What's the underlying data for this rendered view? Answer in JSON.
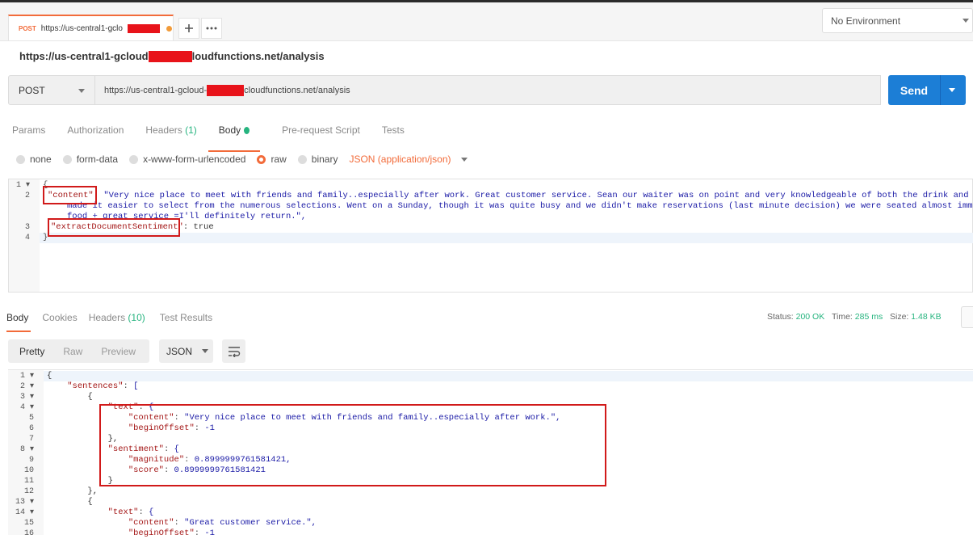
{
  "request_tab": {
    "method": "POST",
    "url": "https://us-central1-gclo"
  },
  "env": {
    "label": "No Environment"
  },
  "title": {
    "pre": "https://us-central1-gcloud",
    "post": "loudfunctions.net/analysis"
  },
  "request": {
    "method": "POST",
    "url_pre": "https://us-central1-gcloud-",
    "url_post": "cloudfunctions.net/analysis",
    "send_label": "Send"
  },
  "req_tabs": {
    "params": "Params",
    "authorization": "Authorization",
    "headers": "Headers",
    "headers_count": "(1)",
    "body": "Body",
    "prerequest": "Pre-request Script",
    "tests": "Tests"
  },
  "body_types": {
    "none": "none",
    "formdata": "form-data",
    "urlencoded": "x-www-form-urlencoded",
    "raw": "raw",
    "binary": "binary",
    "content_type": "JSON (application/json)"
  },
  "request_body": {
    "line1": "{",
    "line2_key": "\"content\"",
    "line2_val": "\"Very nice place to meet with friends and family..especially after work. Great customer service. Sean our waiter was on point and very knowledgeable of both the drink and food",
    "line2_wrap1": "made it easier to select from the numerous selections. Went on a Sunday, though it was quite busy and we didn't make reservations (last minute decision) we were seated almost immedia",
    "line2_wrap2": "food + great service =I'll definitely return.\",",
    "line3_key": "\"extractDocumentSentiment\"",
    "line3_val": " true",
    "line4": "}"
  },
  "resp_tabs": {
    "body": "Body",
    "cookies": "Cookies",
    "headers": "Headers",
    "headers_count": "(10)",
    "tests": "Test Results"
  },
  "status": {
    "status_label": "Status:",
    "status_value": "200 OK",
    "time_label": "Time:",
    "time_value": "285 ms",
    "size_label": "Size:",
    "size_value": "1.48 KB"
  },
  "resp_format": {
    "pretty": "Pretty",
    "raw": "Raw",
    "preview": "Preview",
    "json": "JSON"
  },
  "response_lines": [
    "{",
    "    \"sentences\": [",
    "        {",
    "            \"text\": {",
    "                \"content\": \"Very nice place to meet with friends and family..especially after work.\",",
    "                \"beginOffset\": -1",
    "            },",
    "            \"sentiment\": {",
    "                \"magnitude\": 0.8999999761581421,",
    "                \"score\": 0.8999999761581421",
    "            }",
    "        },",
    "        {",
    "            \"text\": {",
    "                \"content\": \"Great customer service.\",",
    "                \"beginOffset\": -1"
  ]
}
